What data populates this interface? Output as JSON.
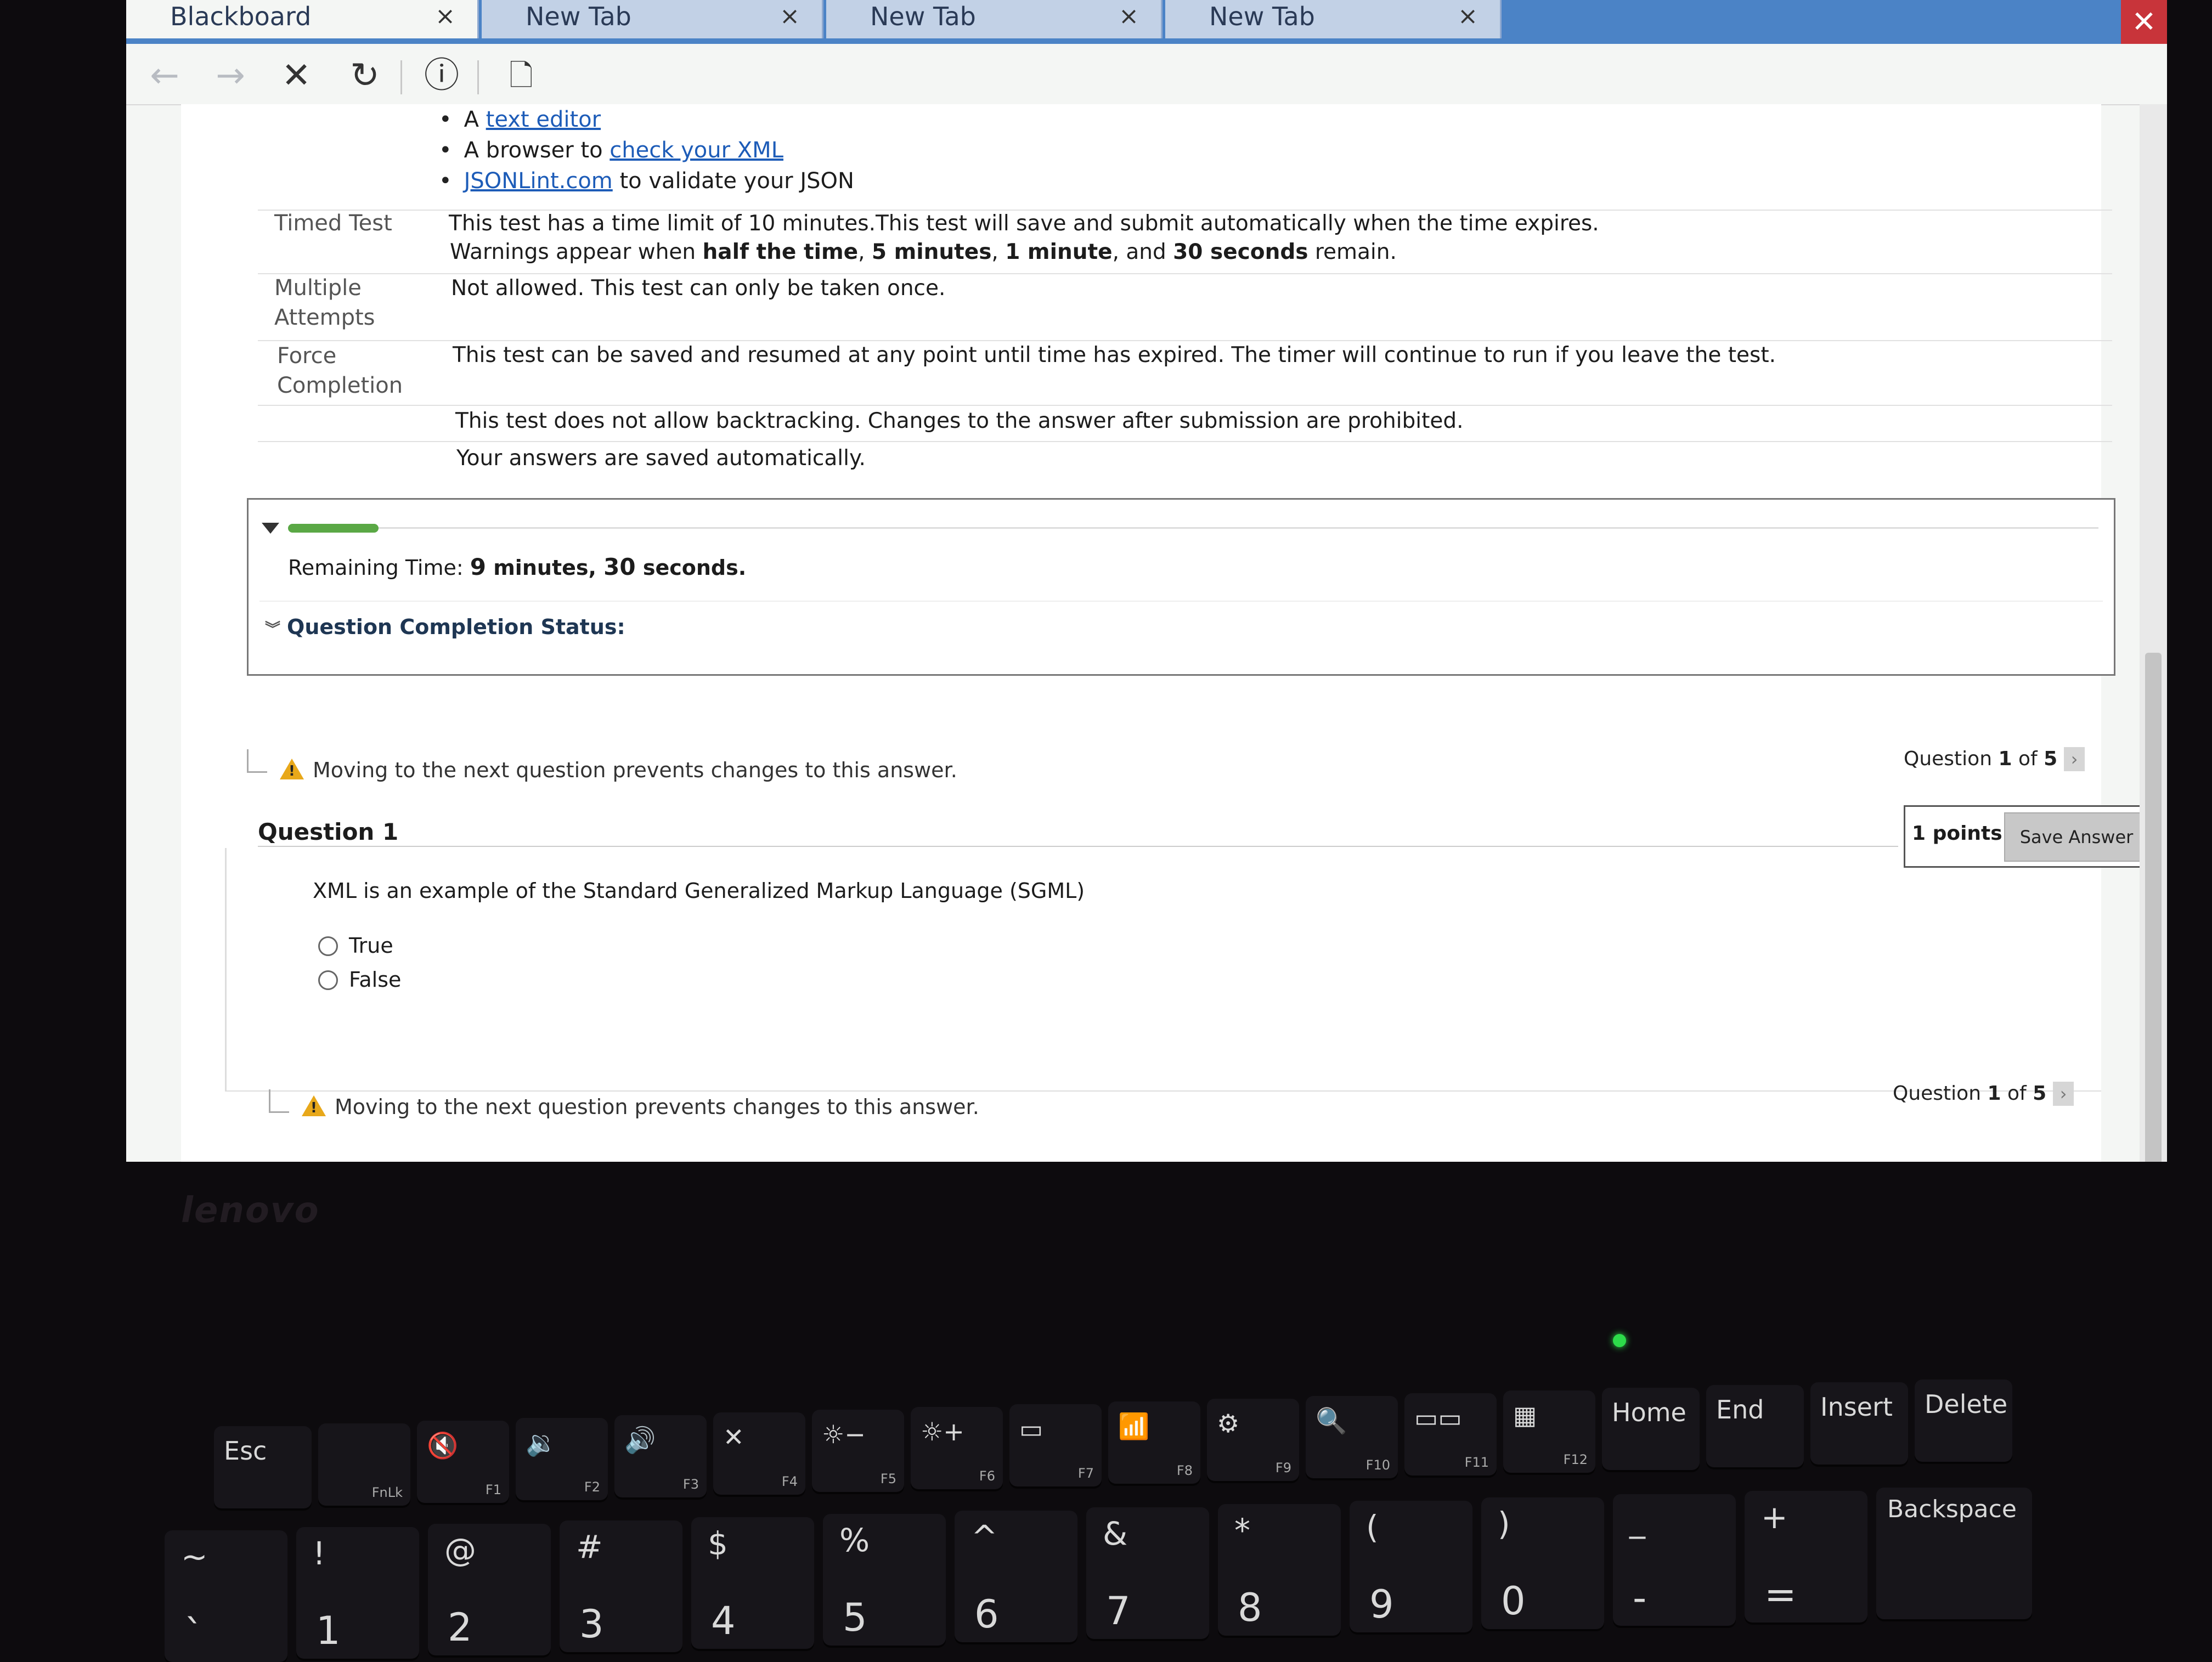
{
  "browser": {
    "tabs": [
      {
        "label": "Blackboard",
        "close": "×"
      },
      {
        "label": "New Tab",
        "close": "×"
      },
      {
        "label": "New Tab",
        "close": "×"
      },
      {
        "label": "New Tab",
        "close": "×"
      }
    ],
    "window_close": "✕",
    "toolbar": {
      "back": "←",
      "forward": "→",
      "stop": "✕",
      "reload": "↻",
      "info": "ⓘ",
      "new_page": "🗋"
    }
  },
  "instructions": {
    "tools": [
      {
        "prefix": "A ",
        "link": "text editor",
        "suffix": ""
      },
      {
        "prefix": "A browser to ",
        "link": "check your XML",
        "suffix": ""
      },
      {
        "prefix": "",
        "link": "JSONLint.com",
        "suffix": " to validate your JSON"
      }
    ],
    "timed_test": {
      "label": "Timed Test",
      "line1": "This test has a time limit of 10 minutes.This test will save and submit automatically when the time expires.",
      "line2_pre": "Warnings appear when ",
      "w1": "half the time",
      "sep1": ", ",
      "w2": "5 minutes",
      "sep2": ", ",
      "w3": "1 minute",
      "sep3": ", and ",
      "w4": "30 seconds",
      "line2_post": " remain."
    },
    "multiple_attempts": {
      "label1": "Multiple",
      "label2": "Attempts",
      "value": "Not allowed. This test can only be taken once."
    },
    "force_completion": {
      "label1": "Force",
      "label2": "Completion",
      "value": "This test can be saved and resumed at any point until time has expired. The timer will continue to run if you leave the test."
    },
    "backtracking": "This test does not allow backtracking. Changes to the answer after submission are prohibited.",
    "autosave": "Your answers are saved automatically."
  },
  "timer": {
    "progress": 0.05,
    "label": "Remaining Time: ",
    "minutes": "9",
    "minutes_unit": " minutes, ",
    "seconds": "30",
    "seconds_unit": " seconds.",
    "status_label": "Question Completion Status:"
  },
  "question": {
    "warning": "Moving to the next question prevents changes to this answer.",
    "nav_pre": "Question ",
    "nav_current": "1",
    "nav_mid": " of ",
    "nav_total": "5",
    "title": "Question 1",
    "points": "1 points",
    "save_label": "Save Answer",
    "text": "XML is an example of the Standard Generalized Markup Language (SGML)",
    "options": [
      "True",
      "False"
    ]
  },
  "laptop": {
    "brand": "lenovo",
    "fkeys": [
      {
        "label": "Esc",
        "fn": ""
      },
      {
        "label": "",
        "fn": "FnLk"
      },
      {
        "label": "🔇",
        "fn": "F1"
      },
      {
        "label": "🔉",
        "fn": "F2"
      },
      {
        "label": "🔊",
        "fn": "F3"
      },
      {
        "label": "✕",
        "fn": "F4"
      },
      {
        "label": "☼−",
        "fn": "F5"
      },
      {
        "label": "☼+",
        "fn": "F6"
      },
      {
        "label": "▭",
        "fn": "F7"
      },
      {
        "label": "📶",
        "fn": "F8"
      },
      {
        "label": "⚙",
        "fn": "F9"
      },
      {
        "label": "🔍",
        "fn": "F10"
      },
      {
        "label": "▭▭",
        "fn": "F11"
      },
      {
        "label": "▦",
        "fn": "F12"
      },
      {
        "label": "Home",
        "fn": ""
      },
      {
        "label": "End",
        "fn": ""
      },
      {
        "label": "Insert",
        "fn": ""
      },
      {
        "label": "Delete",
        "fn": ""
      }
    ],
    "numkeys": [
      {
        "top": "~",
        "bottom": "`"
      },
      {
        "top": "!",
        "bottom": "1"
      },
      {
        "top": "@",
        "bottom": "2"
      },
      {
        "top": "#",
        "bottom": "3"
      },
      {
        "top": "$",
        "bottom": "4"
      },
      {
        "top": "%",
        "bottom": "5"
      },
      {
        "top": "^",
        "bottom": "6"
      },
      {
        "top": "&",
        "bottom": "7"
      },
      {
        "top": "*",
        "bottom": "8"
      },
      {
        "top": "(",
        "bottom": "9"
      },
      {
        "top": ")",
        "bottom": "0"
      },
      {
        "top": "_",
        "bottom": "-"
      },
      {
        "top": "+",
        "bottom": "="
      },
      {
        "top": "Backspace",
        "bottom": ""
      }
    ]
  }
}
